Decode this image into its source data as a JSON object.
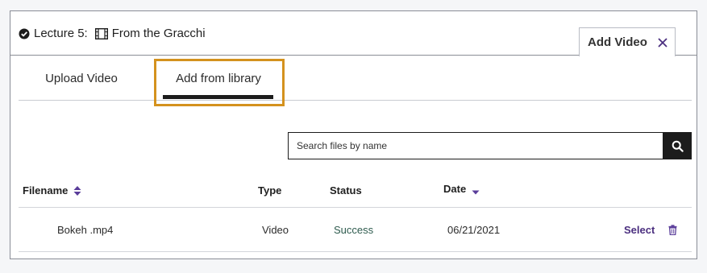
{
  "lecture": {
    "prefix": "Lecture 5:",
    "title": "From the Gracchi"
  },
  "panel_tab": {
    "label": "Add Video"
  },
  "tabs": [
    {
      "label": "Upload Video"
    },
    {
      "label": "Add from library"
    }
  ],
  "search": {
    "placeholder": "Search files by name"
  },
  "table": {
    "columns": [
      "Filename",
      "Type",
      "Status",
      "Date"
    ],
    "rows": [
      {
        "filename": "Bokeh .mp4",
        "type": "Video",
        "status": "Success",
        "date": "06/21/2021",
        "action": "Select"
      }
    ]
  },
  "colors": {
    "accent_purple": "#4b2f7f",
    "highlight_frame": "#d4921e",
    "status_green": "#2e5b4e"
  },
  "icons": {
    "lecture": "check-circle-icon",
    "media": "film-icon",
    "close": "close-icon",
    "search": "search-icon",
    "sort_filename": "sort-both-icon",
    "sort_date": "sort-down-icon",
    "delete": "trash-icon"
  }
}
